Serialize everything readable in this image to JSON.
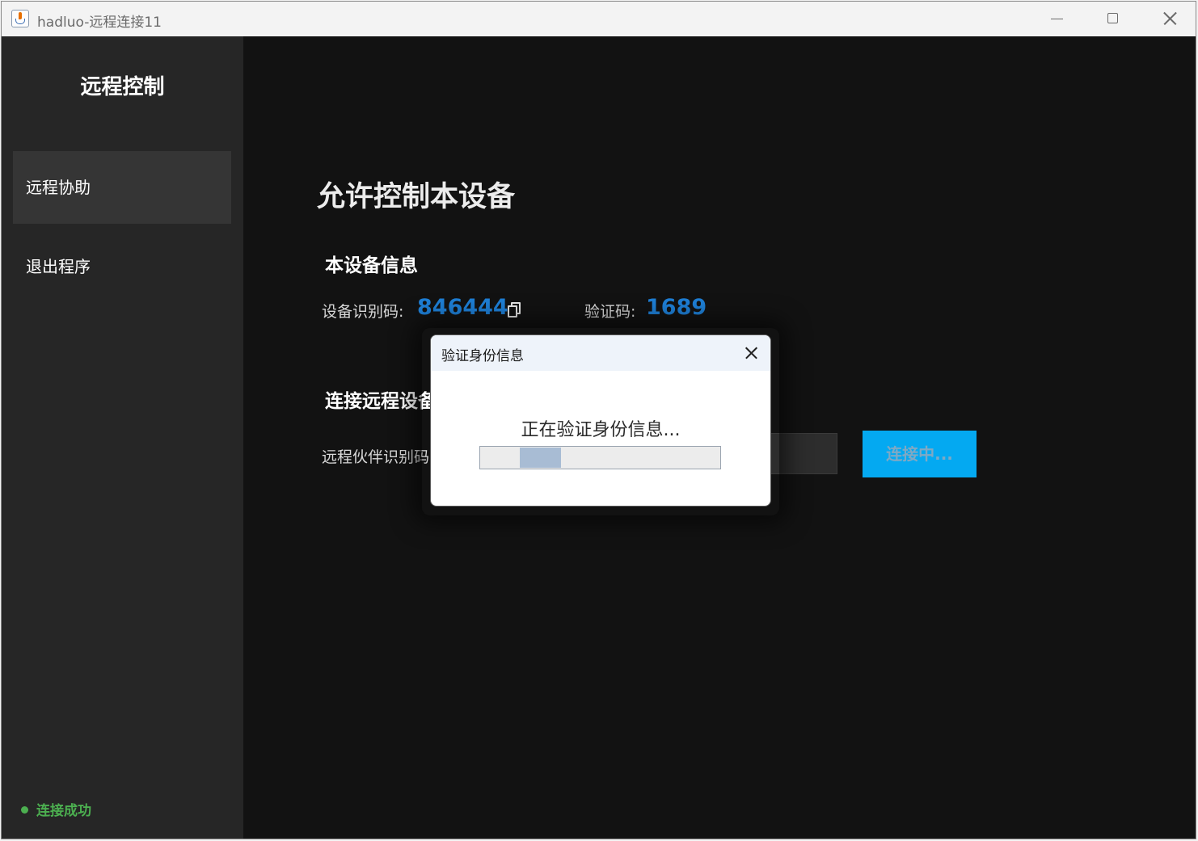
{
  "window": {
    "title": "hadluo-远程连接11"
  },
  "sidebar": {
    "brand": "远程控制",
    "items": [
      {
        "label": "远程协助",
        "active": true
      },
      {
        "label": "退出程序",
        "active": false
      }
    ],
    "status": "连接成功",
    "status_color": "#4caf50"
  },
  "main": {
    "title": "允许控制本设备",
    "device_section_title": "本设备信息",
    "device_id_label": "设备识别码:",
    "device_id": "846444",
    "verify_label": "验证码:",
    "verify_code": "1689",
    "connect_section_title": "连接远程设备",
    "partner_label": "远程伙伴识别码:",
    "partner_value": "",
    "connect_button": "连接中...",
    "accent_color": "#1e7fd6",
    "button_color": "#04a9f1"
  },
  "dialog": {
    "title": "验证身份信息",
    "message": "正在验证身份信息...",
    "progress_state": "indeterminate"
  },
  "icons": [
    "java-app-icon",
    "minimize-icon",
    "maximize-icon",
    "close-icon",
    "copy-icon",
    "status-dot-icon"
  ]
}
